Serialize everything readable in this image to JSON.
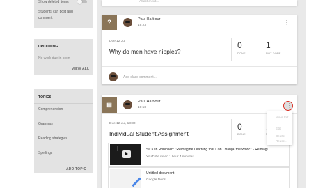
{
  "sidebar": {
    "settings": {
      "show_deleted": "Show deleted items",
      "students_can_post_1": "Students can post and",
      "students_can_post_2": "comment"
    },
    "upcoming": {
      "heading": "UPCOMING",
      "empty_text": "No work due in soon",
      "view_all": "VIEW ALL"
    },
    "topics": {
      "heading": "TOPICS",
      "items": [
        "Comprehension",
        "Grammar",
        "Reading strategies",
        "Spellings"
      ],
      "add_topic": "ADD TOPIC"
    }
  },
  "stream": {
    "top_snippet": "Attachment...",
    "posts": [
      {
        "type_icon": "question-icon",
        "type_glyph": "?",
        "author": "Paul Harbour",
        "time": "19:23",
        "due": "Due 12 Jul",
        "title": "Why do men have nipples?",
        "done_count": "0",
        "done_label": "DONE",
        "not_done_count": "1",
        "not_done_label": "NOT DONE",
        "comment_placeholder": "Add class comment..."
      },
      {
        "type_icon": "assignment-icon",
        "type_glyph": "▤",
        "author": "Paul Harbour",
        "time": "19:18",
        "due": "Due 12 Jul, 13:30",
        "title": "Individual Student Assignment",
        "done_count": "0",
        "done_label": "DONE",
        "not_done_count": "1",
        "not_done_label": "NOT DONE",
        "attachments": [
          {
            "kind": "youtube",
            "title": "Sir Ken Robinson: \"Reimagine Learning that Can Change the World\" - Reimagi...",
            "subtitle": "YouTube video  1 hour 4 minutes"
          },
          {
            "kind": "doc",
            "title": "Untitled document",
            "subtitle": "Google Docs"
          }
        ],
        "menu_items": [
          "Move to t...",
          "Edit",
          "Delete",
          "Reuse..."
        ]
      }
    ]
  },
  "colors": {
    "stream_bg": "#e9e9e9",
    "sidebar_card": "#e3e3e3",
    "type_icon_bg": "#8a7558",
    "accent_red": "#d93025"
  }
}
